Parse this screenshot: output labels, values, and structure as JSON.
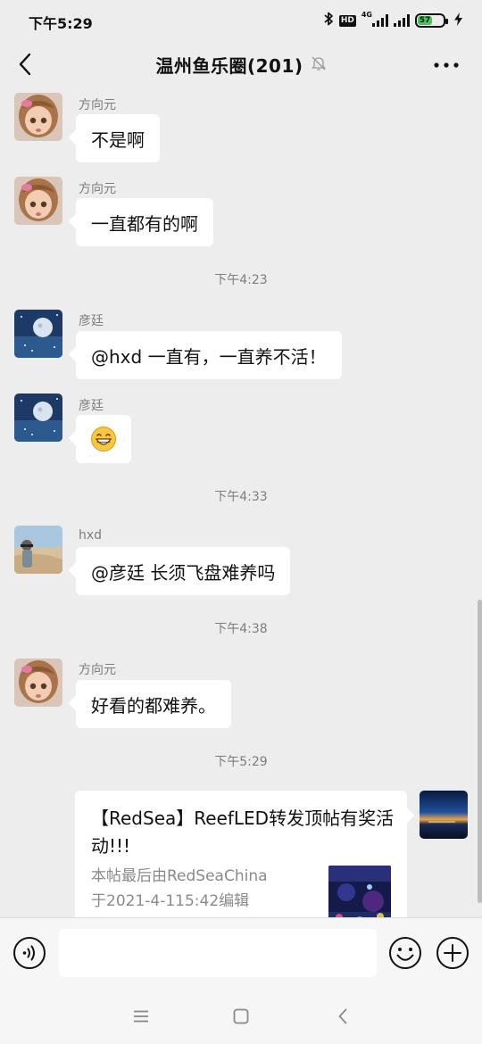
{
  "status_bar": {
    "time": "下午5:29",
    "hd_label": "HD",
    "network_label": "4G",
    "battery_level": 57,
    "battery_text": "57",
    "icons": [
      "bluetooth-icon",
      "hd-icon",
      "signal-icon",
      "signal-icon",
      "battery-icon",
      "charging-icon"
    ]
  },
  "nav": {
    "title": "温州鱼乐圈(201)",
    "icons": [
      "back-icon",
      "mute-bell-icon",
      "more-icon"
    ]
  },
  "messages": [
    {
      "sender": "方向元",
      "text": "不是啊"
    },
    {
      "sender": "方向元",
      "text": "一直都有的啊"
    },
    {
      "timestamp": "下午4:23"
    },
    {
      "sender": "彦廷",
      "text": "@hxd 一直有，一直养不活！"
    },
    {
      "sender": "彦廷",
      "emoji": "grin-emoji"
    },
    {
      "timestamp": "下午4:33"
    },
    {
      "sender": "hxd",
      "text": "@彦廷  长须飞盘难养吗"
    },
    {
      "timestamp": "下午4:38"
    },
    {
      "sender": "方向元",
      "text": "好看的都难养。"
    },
    {
      "timestamp": "下午5:29"
    },
    {
      "sender": "",
      "is_self": true,
      "card": {
        "title": "【RedSea】ReefLED转发顶帖有奖活动!!!",
        "desc_line1": "本帖最后由RedSeaChina",
        "desc_line2": "于2021-4-115:42编辑"
      }
    }
  ],
  "input_bar": {
    "placeholder": "",
    "icons": [
      "voice-icon",
      "emoji-icon",
      "plus-icon"
    ]
  },
  "system_nav": {
    "icons": [
      "menu-icon",
      "home-icon",
      "back-nav-icon"
    ]
  },
  "colors": {
    "background": "#ededed",
    "bubble": "#ffffff",
    "meta_text": "#7d7d7d",
    "battery_fill": "#43c95a"
  }
}
